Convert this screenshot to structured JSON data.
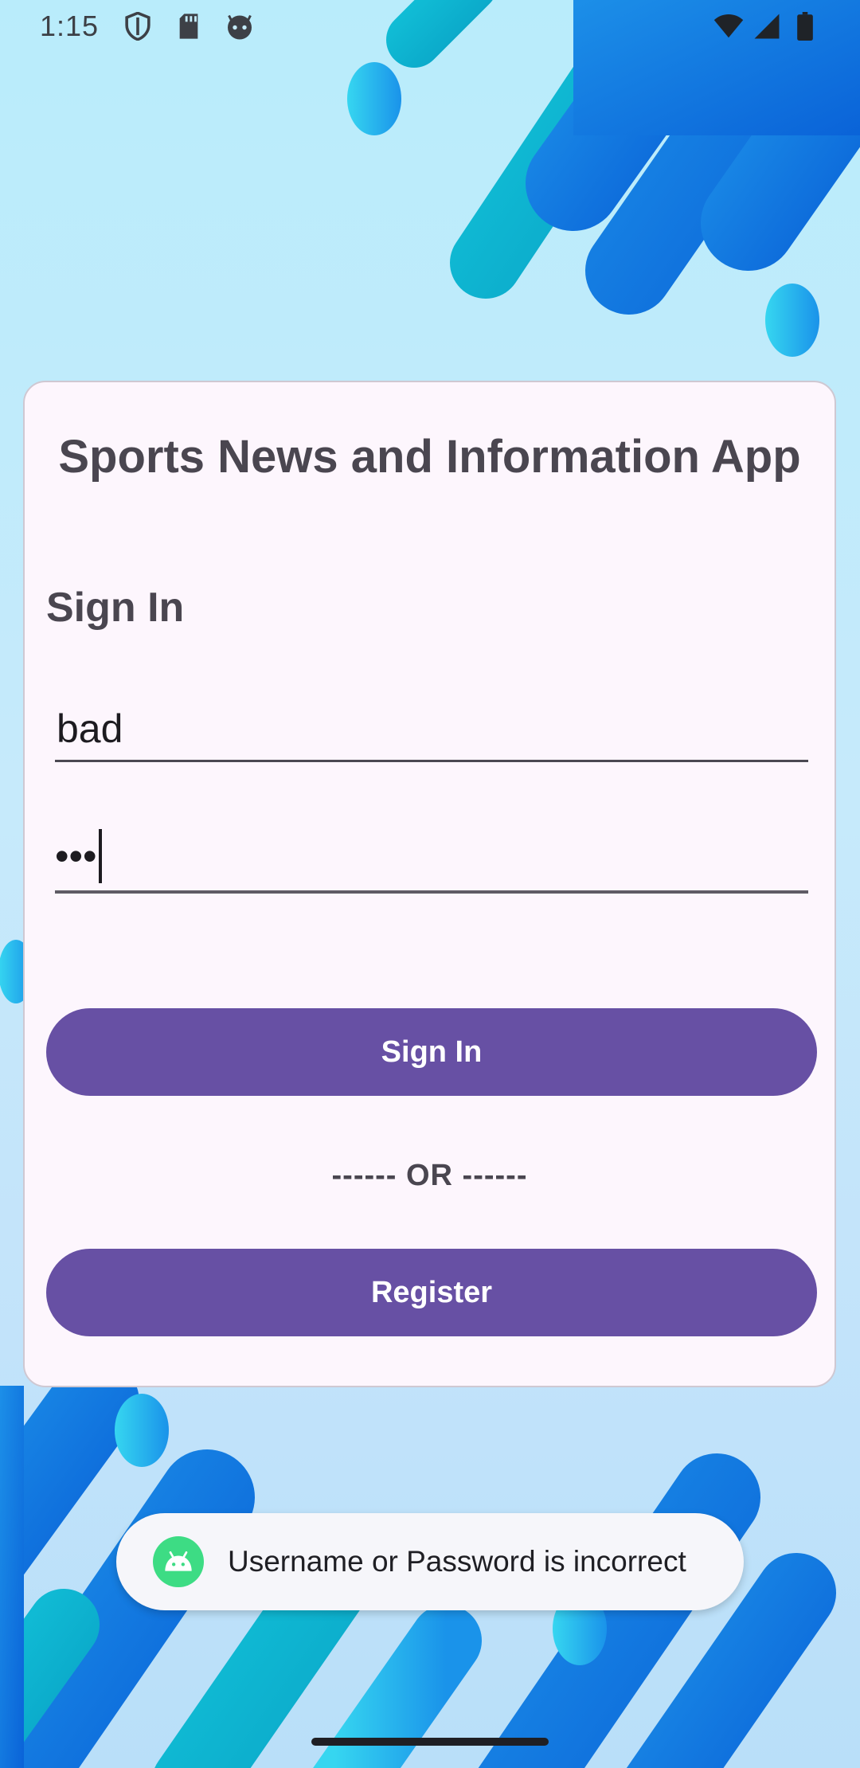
{
  "status_bar": {
    "time": "1:15",
    "left_icons": [
      "shield-icon",
      "sd-card-icon",
      "android-head-icon"
    ],
    "right_icons": [
      "wifi-icon",
      "cell-signal-icon",
      "battery-icon"
    ]
  },
  "card": {
    "app_title": "Sports News and Information App",
    "section_title": "Sign In",
    "username": {
      "value": "bad"
    },
    "password": {
      "masked_value": "•••"
    },
    "signin_label": "Sign In",
    "or_text": "------ OR ------",
    "register_label": "Register"
  },
  "toast": {
    "icon": "android-icon",
    "message": "Username or Password is incorrect"
  },
  "colors": {
    "primary": "#6750a4",
    "card_bg": "#fdf6fd",
    "toast_icon": "#3ddc84"
  }
}
